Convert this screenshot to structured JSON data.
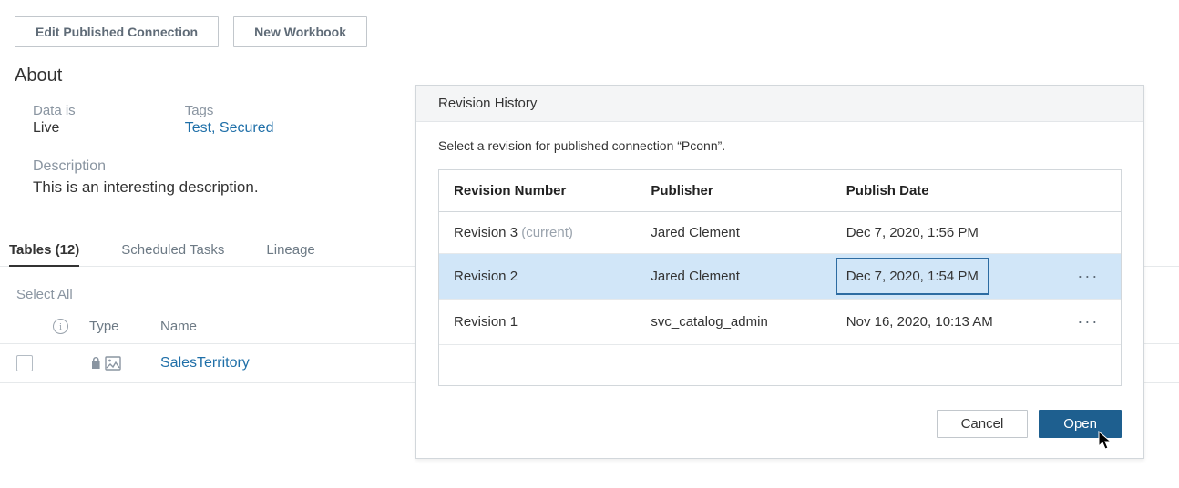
{
  "toolbar": {
    "edit_connection": "Edit Published Connection",
    "new_workbook": "New Workbook"
  },
  "about": {
    "heading": "About",
    "data_is_label": "Data is",
    "data_is_value": "Live",
    "tags_label": "Tags",
    "tags_value": "Test, Secured",
    "description_label": "Description",
    "description_text": "This is an interesting description."
  },
  "tabs": {
    "tables": "Tables (12)",
    "scheduled": "Scheduled Tasks",
    "lineage": "Lineage"
  },
  "table": {
    "select_all": "Select All",
    "col_type": "Type",
    "col_name": "Name",
    "row_name": "SalesTerritory"
  },
  "dialog": {
    "title": "Revision History",
    "instruction": "Select a revision for published connection “Pconn”.",
    "col_number": "Revision Number",
    "col_publisher": "Publisher",
    "col_date": "Publish Date",
    "rows": [
      {
        "number": "Revision 3",
        "current": "(current)",
        "publisher": "Jared Clement",
        "date": "Dec 7, 2020, 1:56 PM"
      },
      {
        "number": "Revision 2",
        "current": "",
        "publisher": "Jared Clement",
        "date": "Dec 7, 2020, 1:54 PM"
      },
      {
        "number": "Revision 1",
        "current": "",
        "publisher": "svc_catalog_admin",
        "date": "Nov 16, 2020, 10:13 AM"
      }
    ],
    "cancel": "Cancel",
    "open": "Open"
  }
}
